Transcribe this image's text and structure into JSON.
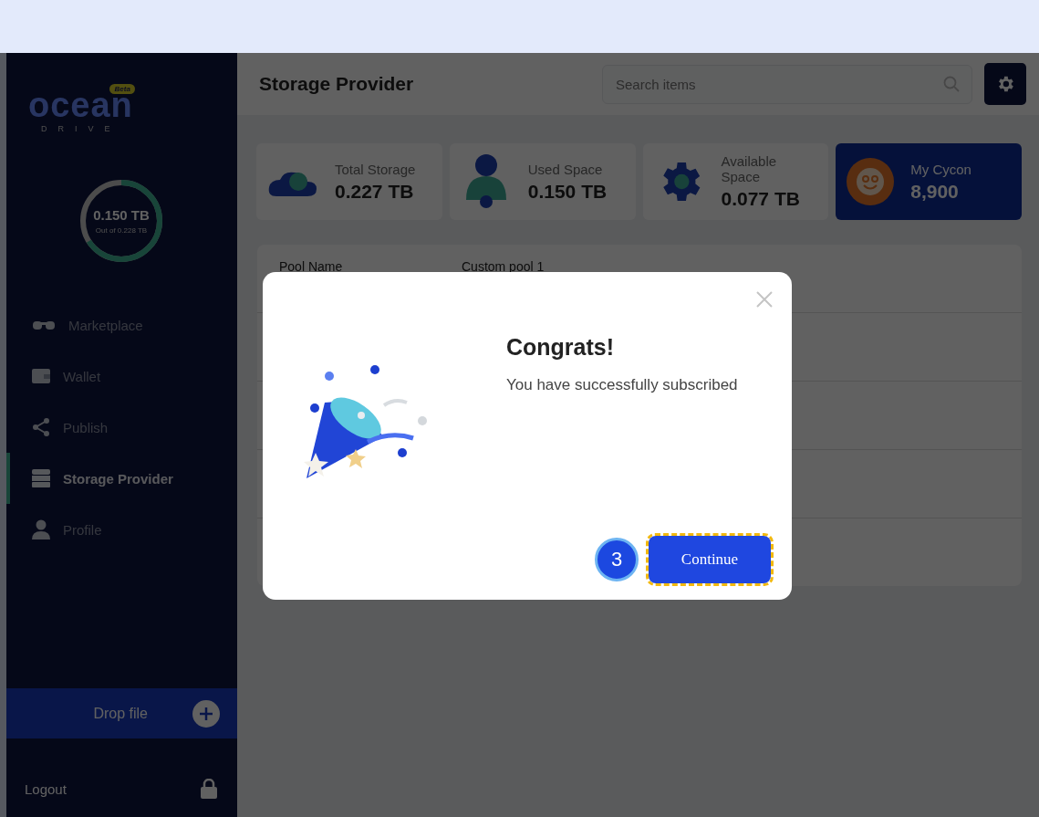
{
  "sidebar": {
    "logo": {
      "wordmark": "ocean",
      "sub": "DRIVE",
      "badge": "Beta"
    },
    "storage_meter": {
      "value": "0.150 TB",
      "caption": "Out of 0.228 TB",
      "level": 0.66
    },
    "nav": [
      {
        "label": "Marketplace",
        "kind": "market",
        "selected": false
      },
      {
        "label": "Wallet",
        "kind": "wallet",
        "selected": false
      },
      {
        "label": "Publish",
        "kind": "share",
        "selected": false
      },
      {
        "label": "Storage Provider",
        "kind": "storage",
        "selected": true
      },
      {
        "label": "Profile",
        "kind": "user",
        "selected": false
      }
    ],
    "drop_button": "Drop file",
    "logout": "Logout"
  },
  "header": {
    "title": "Storage Provider",
    "search": {
      "placeholder": "Search items"
    }
  },
  "stats": [
    {
      "label": "Total Storage",
      "value": "0.227 TB",
      "kind": "cloud",
      "highlighted": false
    },
    {
      "label": "Used Space",
      "value": "0.150 TB",
      "kind": "person",
      "highlighted": false
    },
    {
      "label": "Available Space",
      "value": "0.077 TB",
      "kind": "gear",
      "highlighted": false
    },
    {
      "label": "My Cycon",
      "value": "8,900",
      "kind": "coin",
      "highlighted": true
    }
  ],
  "table": {
    "rows": [
      {
        "label": "Pool Name",
        "value": "Custom pool 1"
      }
    ]
  },
  "dialog": {
    "title": "Congrats!",
    "message": "You have successfully subscribed",
    "button": "Continue",
    "step": "3"
  }
}
